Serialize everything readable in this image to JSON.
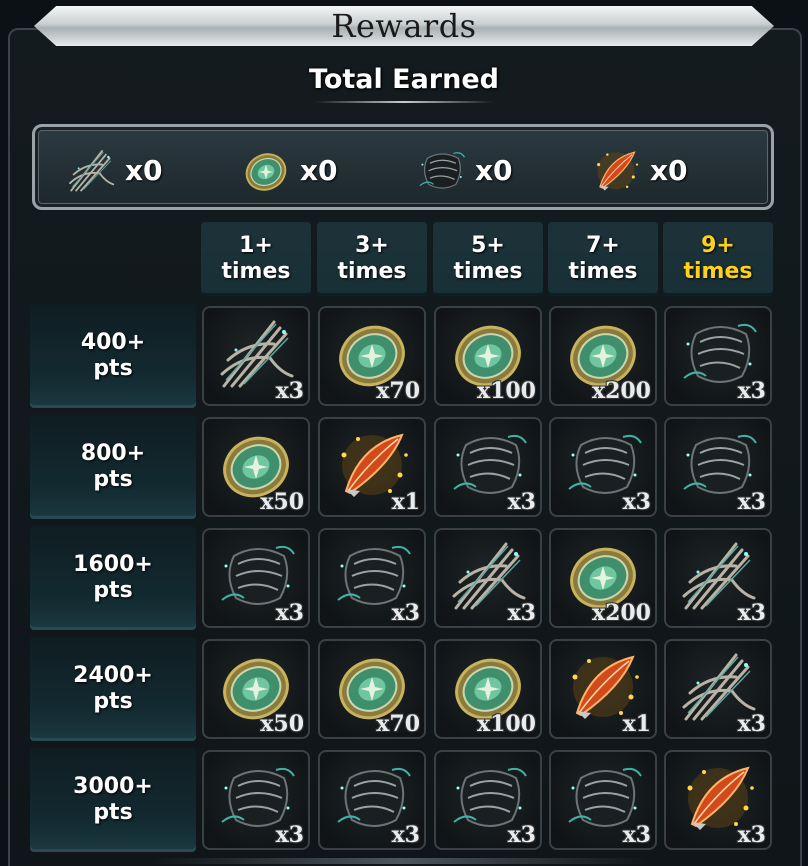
{
  "header": {
    "title": "Rewards",
    "subtitle": "Total Earned"
  },
  "totals": [
    {
      "icon": "feather-wing-icon",
      "count": "x0"
    },
    {
      "icon": "green-coin-icon",
      "count": "x0"
    },
    {
      "icon": "dark-crest-icon",
      "count": "x0"
    },
    {
      "icon": "orange-feather-icon",
      "count": "x0"
    }
  ],
  "columns": [
    {
      "line1": "1+",
      "line2": "times",
      "highlight": false
    },
    {
      "line1": "3+",
      "line2": "times",
      "highlight": false
    },
    {
      "line1": "5+",
      "line2": "times",
      "highlight": false
    },
    {
      "line1": "7+",
      "line2": "times",
      "highlight": false
    },
    {
      "line1": "9+",
      "line2": "times",
      "highlight": true
    }
  ],
  "rows": [
    {
      "line1": "400+",
      "line2": "pts",
      "cells": [
        {
          "icon": "feather-wing-icon",
          "qty": "x3"
        },
        {
          "icon": "green-coin-icon",
          "qty": "x70"
        },
        {
          "icon": "green-coin-icon",
          "qty": "x100"
        },
        {
          "icon": "green-coin-icon",
          "qty": "x200"
        },
        {
          "icon": "dark-crest-icon",
          "qty": "x3"
        }
      ]
    },
    {
      "line1": "800+",
      "line2": "pts",
      "cells": [
        {
          "icon": "green-coin-icon",
          "qty": "x50"
        },
        {
          "icon": "orange-feather-icon",
          "qty": "x1"
        },
        {
          "icon": "dark-crest-icon",
          "qty": "x3"
        },
        {
          "icon": "dark-crest-icon",
          "qty": "x3"
        },
        {
          "icon": "dark-crest-icon",
          "qty": "x3"
        }
      ]
    },
    {
      "line1": "1600+",
      "line2": "pts",
      "cells": [
        {
          "icon": "dark-crest-icon",
          "qty": "x3"
        },
        {
          "icon": "dark-crest-icon",
          "qty": "x3"
        },
        {
          "icon": "feather-wing-icon",
          "qty": "x3"
        },
        {
          "icon": "green-coin-icon",
          "qty": "x200"
        },
        {
          "icon": "feather-wing-icon",
          "qty": "x3"
        }
      ]
    },
    {
      "line1": "2400+",
      "line2": "pts",
      "cells": [
        {
          "icon": "green-coin-icon",
          "qty": "x50"
        },
        {
          "icon": "green-coin-icon",
          "qty": "x70"
        },
        {
          "icon": "green-coin-icon",
          "qty": "x100"
        },
        {
          "icon": "orange-feather-icon",
          "qty": "x1"
        },
        {
          "icon": "feather-wing-icon",
          "qty": "x3"
        }
      ]
    },
    {
      "line1": "3000+",
      "line2": "pts",
      "cells": [
        {
          "icon": "dark-crest-icon",
          "qty": "x3"
        },
        {
          "icon": "dark-crest-icon",
          "qty": "x3"
        },
        {
          "icon": "dark-crest-icon",
          "qty": "x3"
        },
        {
          "icon": "dark-crest-icon",
          "qty": "x3"
        },
        {
          "icon": "orange-feather-icon",
          "qty": "x3"
        }
      ]
    }
  ],
  "colors": {
    "highlight": "#ffd21a",
    "header_bg": "#1d3238",
    "cell_border": "#3a4145"
  }
}
